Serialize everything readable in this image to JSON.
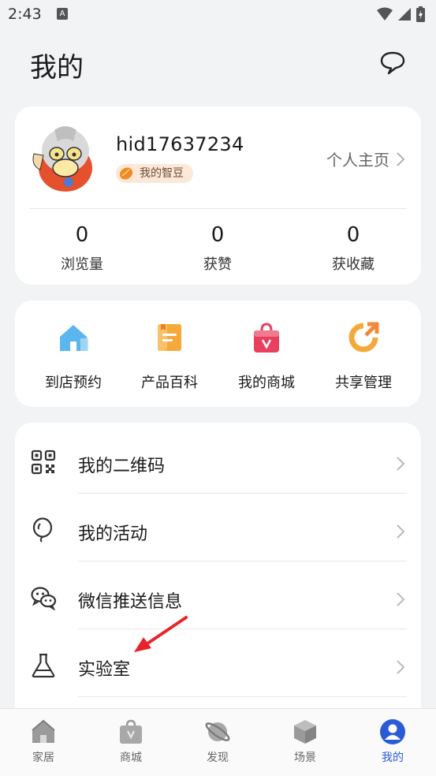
{
  "status_bar": {
    "time": "2:43",
    "notification_icon": "a-icon"
  },
  "header": {
    "title": "我的",
    "message_icon": "chat-bubble-icon"
  },
  "profile": {
    "username": "hid17637234",
    "badge": "我的智豆",
    "homepage_link": "个人主页",
    "stats": [
      {
        "value": "0",
        "label": "浏览量"
      },
      {
        "value": "0",
        "label": "获赞"
      },
      {
        "value": "0",
        "label": "获收藏"
      }
    ]
  },
  "shortcuts": [
    {
      "label": "到店预约",
      "icon": "store-house-icon"
    },
    {
      "label": "产品百科",
      "icon": "document-icon"
    },
    {
      "label": "我的商城",
      "icon": "shopping-bag-icon"
    },
    {
      "label": "共享管理",
      "icon": "share-icon"
    }
  ],
  "menu": [
    {
      "label": "我的二维码",
      "icon": "qrcode-icon"
    },
    {
      "label": "我的活动",
      "icon": "balloon-icon"
    },
    {
      "label": "微信推送信息",
      "icon": "wechat-icon"
    },
    {
      "label": "实验室",
      "icon": "flask-icon"
    }
  ],
  "tabs": [
    {
      "label": "家居",
      "icon": "home-icon",
      "active": false
    },
    {
      "label": "商城",
      "icon": "bag-icon",
      "active": false
    },
    {
      "label": "发现",
      "icon": "planet-icon",
      "active": false
    },
    {
      "label": "场景",
      "icon": "cube-icon",
      "active": false
    },
    {
      "label": "我的",
      "icon": "user-icon",
      "active": true
    }
  ],
  "colors": {
    "background": "#f1f3f5",
    "active_tab": "#2a5bd7",
    "badge_bg": "#fde8d8",
    "annotation_arrow": "#e8232a"
  }
}
